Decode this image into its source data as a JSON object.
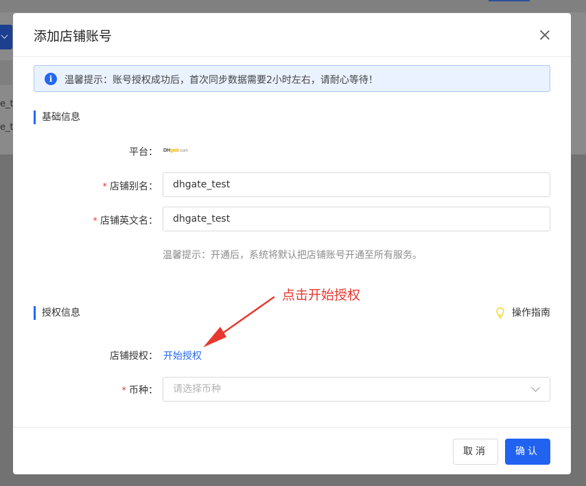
{
  "background": {
    "row_texts": [
      "e_t",
      "e_t"
    ]
  },
  "modal": {
    "title": "添加店铺账号",
    "notice": "温馨提示：账号授权成功后，首次同步数据需要2小时左右，请耐心等待！",
    "sections": {
      "basic": "基础信息",
      "auth": "授权信息"
    },
    "fields": {
      "platform_label": "平台：",
      "platform_logo": {
        "brand": "DH",
        "accent": "gate",
        "suffix": ".com"
      },
      "alias_label": "店铺别名：",
      "alias_value": "dhgate_test",
      "english_name_label": "店铺英文名：",
      "english_name_value": "dhgate_test",
      "hint": "温馨提示：开通后，系统将默认把店铺账号开通至所有服务。",
      "auth_label": "店铺授权：",
      "auth_link": "开始授权",
      "currency_label": "币种：",
      "currency_placeholder": "请选择币种"
    },
    "required_mark": "*",
    "guide_label": "操作指南",
    "annotation": "点击开始授权",
    "buttons": {
      "cancel": "取消",
      "ok": "确认"
    },
    "colors": {
      "accent": "#2468f2",
      "annotation": "#e8372e",
      "required": "#e4393c"
    }
  }
}
